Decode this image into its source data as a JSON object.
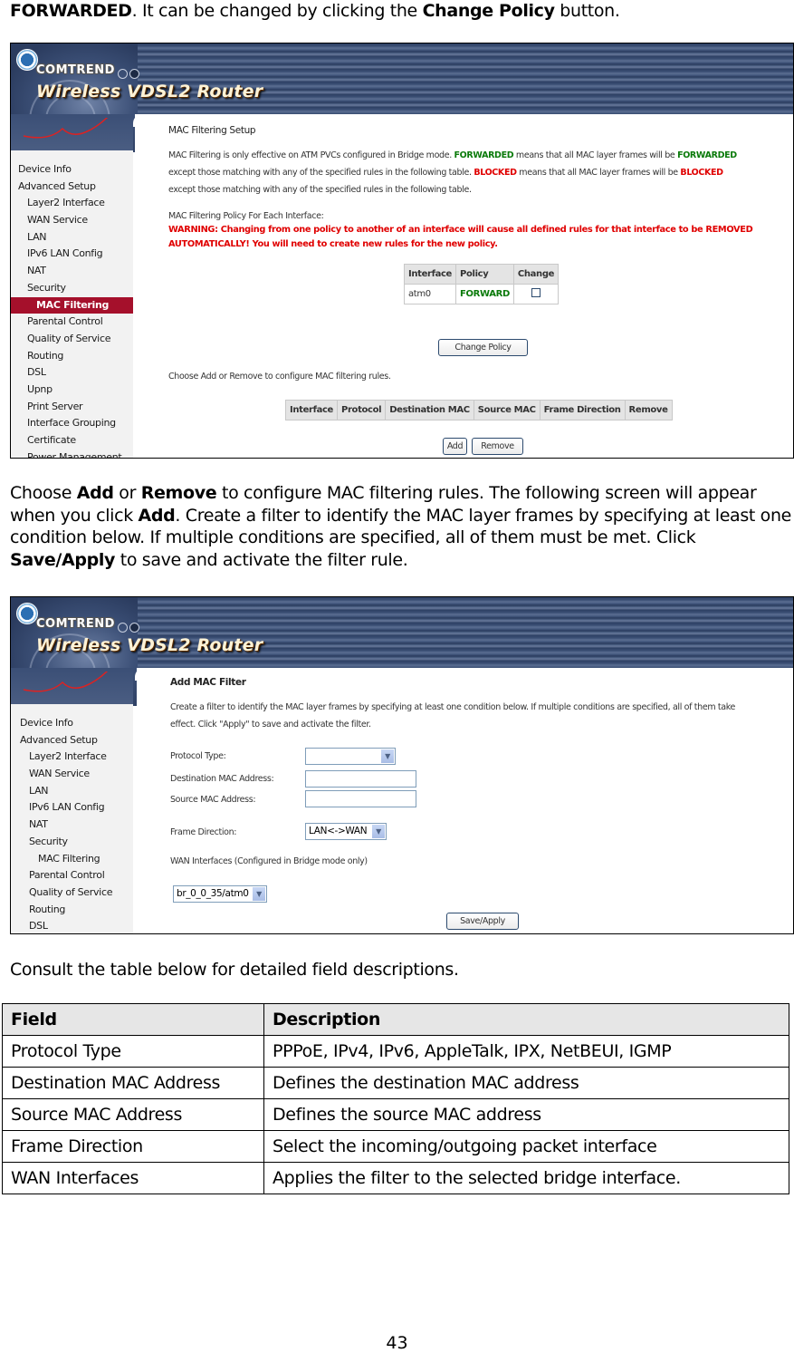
{
  "intro": {
    "segments": [
      {
        "text": "FORWARDED",
        "bold": true
      },
      {
        "text": ". It can be changed by clicking the ",
        "bold": false
      },
      {
        "text": "Change Policy",
        "bold": true
      },
      {
        "text": " button.",
        "bold": false
      }
    ]
  },
  "router": {
    "brand": "COMTREND",
    "product": "Wireless VDSL2 Router",
    "colors": {
      "nav_active": "#a5102b",
      "forwarded": "#0a7a0a",
      "blocked": "#e00000",
      "banner": "#3a4e74"
    }
  },
  "shot1": {
    "nav": [
      {
        "label": "Device Info",
        "level": 0
      },
      {
        "label": "Advanced Setup",
        "level": 0
      },
      {
        "label": "Layer2 Interface",
        "level": 1
      },
      {
        "label": "WAN Service",
        "level": 1
      },
      {
        "label": "LAN",
        "level": 1
      },
      {
        "label": "IPv6 LAN Config",
        "level": 1
      },
      {
        "label": "NAT",
        "level": 1
      },
      {
        "label": "Security",
        "level": 1
      },
      {
        "label": "MAC Filtering",
        "level": 2,
        "active": true
      },
      {
        "label": "Parental Control",
        "level": 1
      },
      {
        "label": "Quality of Service",
        "level": 1
      },
      {
        "label": "Routing",
        "level": 1
      },
      {
        "label": "DSL",
        "level": 1
      },
      {
        "label": "Upnp",
        "level": 1
      },
      {
        "label": "Print Server",
        "level": 1
      },
      {
        "label": "Interface Grouping",
        "level": 1
      },
      {
        "label": "Certificate",
        "level": 1
      },
      {
        "label": "Power Management",
        "level": 1
      }
    ],
    "title": "MAC Filtering Setup",
    "desc": {
      "p1a": "MAC Filtering is only effective on ATM PVCs configured in Bridge mode. ",
      "fwd1": "FORWARDED",
      "p1b": " means that all MAC layer frames will be ",
      "fwd2": "FORWARDED",
      "p2a": "except those matching with any of the specified rules in the following table. ",
      "blk1": "BLOCKED",
      "p2b": " means that all MAC layer frames will be ",
      "blk2": "BLOCKED",
      "p3": "except those matching with any of the specified rules in the following table."
    },
    "policy_heading": "MAC Filtering Policy For Each Interface:",
    "warning_line1": "WARNING: Changing from one policy to another of an interface will cause all defined rules for that interface to be REMOVED",
    "warning_line2": "AUTOMATICALLY! You will need to create new rules for the new policy.",
    "policy_table": {
      "headers": [
        "Interface",
        "Policy",
        "Change"
      ],
      "rows": [
        {
          "interface": "atm0",
          "policy": "FORWARD",
          "change_checked": false
        }
      ]
    },
    "change_policy_button": "Change Policy",
    "rules_hint": "Choose Add or Remove to configure MAC filtering rules.",
    "rules_table": {
      "headers": [
        "Interface",
        "Protocol",
        "Destination MAC",
        "Source MAC",
        "Frame Direction",
        "Remove"
      ]
    },
    "add_button": "Add",
    "remove_button": "Remove"
  },
  "para2": {
    "segments": [
      {
        "text": "Choose ",
        "bold": false
      },
      {
        "text": "Add",
        "bold": true
      },
      {
        "text": " or ",
        "bold": false
      },
      {
        "text": "Remove",
        "bold": true
      },
      {
        "text": " to configure MAC filtering rules. The following screen will appear when you click ",
        "bold": false
      },
      {
        "text": "Add",
        "bold": true
      },
      {
        "text": ". Create a filter to identify the MAC layer frames by specifying at least one condition below. If multiple conditions are specified, all of them must be met. Click ",
        "bold": false
      },
      {
        "text": "Save/Apply",
        "bold": true
      },
      {
        "text": " to save and activate the filter rule.",
        "bold": false
      }
    ]
  },
  "shot2": {
    "nav": [
      {
        "label": "Device Info",
        "level": 0
      },
      {
        "label": "Advanced Setup",
        "level": 0
      },
      {
        "label": "Layer2 Interface",
        "level": 1
      },
      {
        "label": "WAN Service",
        "level": 1
      },
      {
        "label": "LAN",
        "level": 1
      },
      {
        "label": "IPv6 LAN Config",
        "level": 1
      },
      {
        "label": "NAT",
        "level": 1
      },
      {
        "label": "Security",
        "level": 1
      },
      {
        "label": "MAC Filtering",
        "level": 2
      },
      {
        "label": "Parental Control",
        "level": 1
      },
      {
        "label": "Quality of Service",
        "level": 1
      },
      {
        "label": "Routing",
        "level": 1
      },
      {
        "label": "DSL",
        "level": 1
      }
    ],
    "title": "Add MAC Filter",
    "desc_line1": "Create a filter to identify the MAC layer frames by specifying at least one condition below. If multiple conditions are specified, all of them take",
    "desc_line2": "effect. Click \"Apply\" to save and activate the filter.",
    "fields": {
      "protocol_label": "Protocol Type:",
      "protocol_value": "",
      "dest_label": "Destination MAC Address:",
      "dest_value": "",
      "src_label": "Source MAC Address:",
      "src_value": "",
      "direction_label": "Frame Direction:",
      "direction_value": "LAN<->WAN"
    },
    "wan_label": "WAN Interfaces (Configured in Bridge mode only)",
    "wan_value": "br_0_0_35/atm0",
    "save_button": "Save/Apply"
  },
  "consult": "Consult the table below for detailed field descriptions.",
  "field_table": {
    "headers": [
      "Field",
      "Description"
    ],
    "rows": [
      [
        "Protocol Type",
        "PPPoE, IPv4, IPv6, AppleTalk, IPX, NetBEUI, IGMP"
      ],
      [
        "Destination MAC Address",
        "Defines the destination MAC address"
      ],
      [
        "Source MAC Address",
        "Defines the source MAC address"
      ],
      [
        "Frame Direction",
        "Select the incoming/outgoing packet interface"
      ],
      [
        "WAN Interfaces",
        "Applies the filter to the selected bridge interface."
      ]
    ]
  },
  "page_number": "43"
}
